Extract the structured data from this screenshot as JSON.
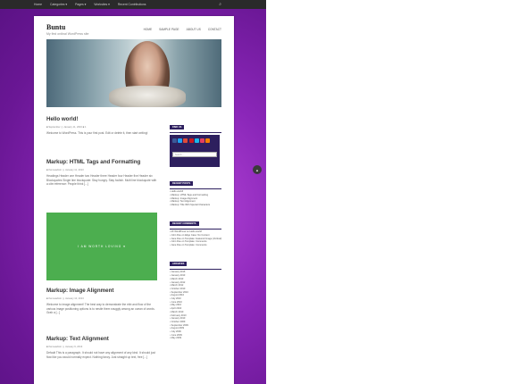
{
  "adminbar": {
    "items": [
      "Home",
      "Categories ▾",
      "Pages ▾",
      "Worksites ▾",
      "Recent Contributions"
    ],
    "search_icon": "search-icon"
  },
  "site": {
    "title": "Buntu",
    "description": "My first ordinal WordPress site"
  },
  "menu": [
    "HOME",
    "SAMPLE PAGE",
    "ABOUT US",
    "CONTACT"
  ],
  "posts": [
    {
      "title": "Hello world!",
      "meta": "■ September  ◷ January 11, 2016  ■ 1",
      "excerpt": "Welcome to WordPress. This is your first post. Edit or delete it, then start writing!"
    },
    {
      "title": "Markup: HTML Tags and Formatting",
      "meta": "■ themeadmin  ◷ January 11, 2013",
      "excerpt": "Headings Header one Header two Header three Header four Header five Header six Blockquotes Single line blockquote: Stay hungry. Stay foolish. Multi line blockquote with a cite reference: People think [...]"
    },
    {
      "title": "Markup: Image Alignment",
      "meta": "■ themeadmin  ◷ January 10, 2013",
      "excerpt": "Welcome to image alignment! The best way to demonstrate the ebb and flow of the various image positioning options is to nestle them snuggly among an ocean of words. Grab a [...]",
      "image_text": "I AM WORTH LOVING ♥"
    },
    {
      "title": "Markup: Text Alignment",
      "meta": "■ themeadmin  ◷ January 9, 2013",
      "excerpt": "Default This is a paragraph. It should not have any alignment of any kind. It should just flow like you would normally expect. Nothing fancy. Just straight up text, free [...]"
    }
  ],
  "sidebar": {
    "follow": {
      "title": "FIND US",
      "search_placeholder": "Search ..."
    },
    "recent_posts": {
      "title": "RECENT POSTS",
      "items": [
        "Hello world!",
        "Markup: HTML Tags and Formatting",
        "Markup: Image Alignment",
        "Markup: Text Alignment",
        "Markup: Title With Special Characters"
      ]
    },
    "recent_comments": {
      "title": "RECENT COMMENTS",
      "items": [
        "Mr WordPress on Hello world!",
        "John Doe on Edge Case: No Content",
        "Jane Doe on Template: Featured Image (Vertical)",
        "John Doe on Template: Comments",
        "Jane Doe on Template: Comments"
      ]
    },
    "archives": {
      "title": "ARCHIVES",
      "items": [
        "January 2016",
        "January 2013",
        "March 2013",
        "January 2012",
        "March 2012",
        "October 2010",
        "September 2010",
        "August 2010",
        "July 2010",
        "June 2010",
        "May 2010",
        "April 2010",
        "March 2010",
        "February 2010",
        "January 2010",
        "October 2009",
        "September 2009",
        "August 2009",
        "July 2009",
        "June 2009",
        "May 2009"
      ]
    }
  },
  "colors": {
    "background": "#8a26b8",
    "widget_header": "#2d1f5e",
    "post_image": "#4cae4f"
  },
  "back_to_top_icon": "arrow-up-icon"
}
